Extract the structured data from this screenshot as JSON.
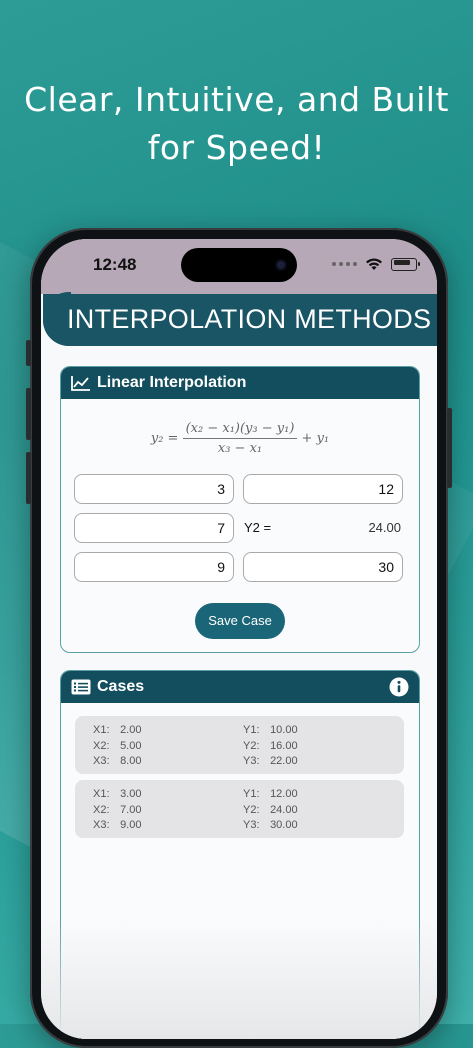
{
  "headline": {
    "line1": "Clear, Intuitive, and Built",
    "line2": "for Speed!"
  },
  "status_bar": {
    "time": "12:48"
  },
  "app": {
    "title": "INTERPOLATION METHODS"
  },
  "linear_card": {
    "title": "Linear Interpolation",
    "icon": "line-chart-icon",
    "formula": {
      "lhs": "y₂ =",
      "numerator": "(x₂ − x₁)(y₃ − y₁)",
      "denominator": "x₃ − x₁",
      "rhs": "+ y₁"
    },
    "fields": {
      "x1": "3",
      "y1": "12",
      "x2": "7",
      "x3": "9",
      "y3": "30"
    },
    "result_label": "Y2 =",
    "result_value": "24.00",
    "save_label": "Save Case"
  },
  "cases_card": {
    "title": "Cases",
    "icon": "list-icon",
    "info_icon": "info-icon",
    "cases": [
      {
        "x1_label": "X1:",
        "x1": "2.00",
        "x2_label": "X2:",
        "x2": "5.00",
        "x3_label": "X3:",
        "x3": "8.00",
        "y1_label": "Y1:",
        "y1": "10.00",
        "y2_label": "Y2:",
        "y2": "16.00",
        "y3_label": "Y3:",
        "y3": "22.00"
      },
      {
        "x1_label": "X1:",
        "x1": "3.00",
        "x2_label": "X2:",
        "x2": "7.00",
        "x3_label": "X3:",
        "x3": "9.00",
        "y1_label": "Y1:",
        "y1": "12.00",
        "y2_label": "Y2:",
        "y2": "24.00",
        "y3_label": "Y3:",
        "y3": "30.00"
      }
    ]
  },
  "colors": {
    "header": "#134e5e",
    "button": "#1a6678",
    "background": "#229792"
  }
}
